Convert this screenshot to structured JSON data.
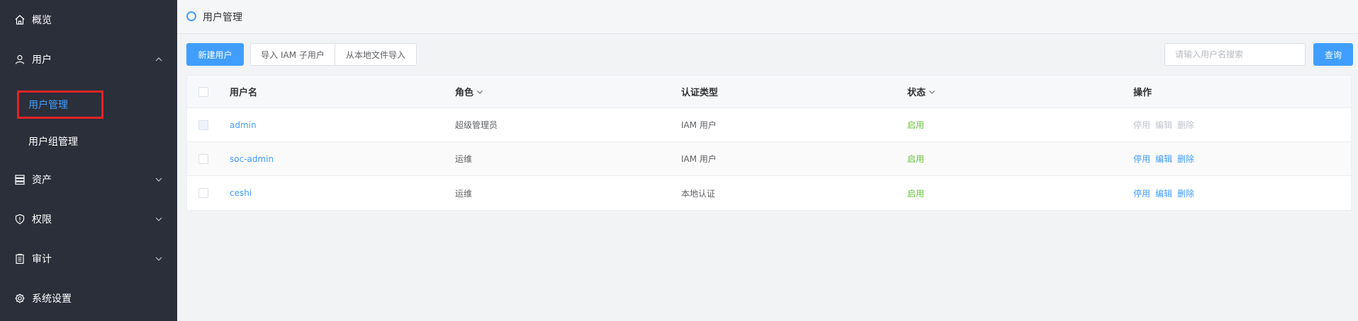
{
  "sidebar": {
    "items": [
      {
        "label": "概览",
        "icon": "home-icon"
      },
      {
        "label": "用户",
        "icon": "user-icon"
      },
      {
        "label": "资产",
        "icon": "asset-icon"
      },
      {
        "label": "权限",
        "icon": "shield-icon"
      },
      {
        "label": "审计",
        "icon": "clipboard-icon"
      },
      {
        "label": "系统设置",
        "icon": "gear-icon"
      }
    ],
    "sub_items": [
      {
        "label": "用户管理",
        "active": true
      },
      {
        "label": "用户组管理",
        "active": false
      }
    ]
  },
  "header": {
    "title": "用户管理"
  },
  "toolbar": {
    "new_user": "新建用户",
    "import_iam": "导入 IAM 子用户",
    "import_local": "从本地文件导入",
    "search_placeholder": "请输入用户名搜索",
    "query": "查询"
  },
  "table": {
    "columns": {
      "name": "用户名",
      "role": "角色",
      "auth": "认证类型",
      "status": "状态",
      "ops": "操作"
    },
    "rows": [
      {
        "name": "admin",
        "role": "超级管理员",
        "auth": "IAM 用户",
        "status": "启用",
        "ops": [
          "停用",
          "编辑",
          "删除"
        ],
        "ops_disabled": true,
        "checkbox_disabled": true
      },
      {
        "name": "soc-admin",
        "role": "运维",
        "auth": "IAM 用户",
        "status": "启用",
        "ops": [
          "停用",
          "编辑",
          "删除"
        ],
        "ops_disabled": false,
        "checkbox_disabled": false
      },
      {
        "name": "ceshi",
        "role": "运维",
        "auth": "本地认证",
        "status": "启用",
        "ops": [
          "停用",
          "编辑",
          "删除"
        ],
        "ops_disabled": false,
        "checkbox_disabled": false
      }
    ]
  },
  "colors": {
    "accent": "#409eff",
    "sidebar_bg": "#2b2f3a",
    "status_on": "#67c23a",
    "highlight": "#e02424"
  }
}
